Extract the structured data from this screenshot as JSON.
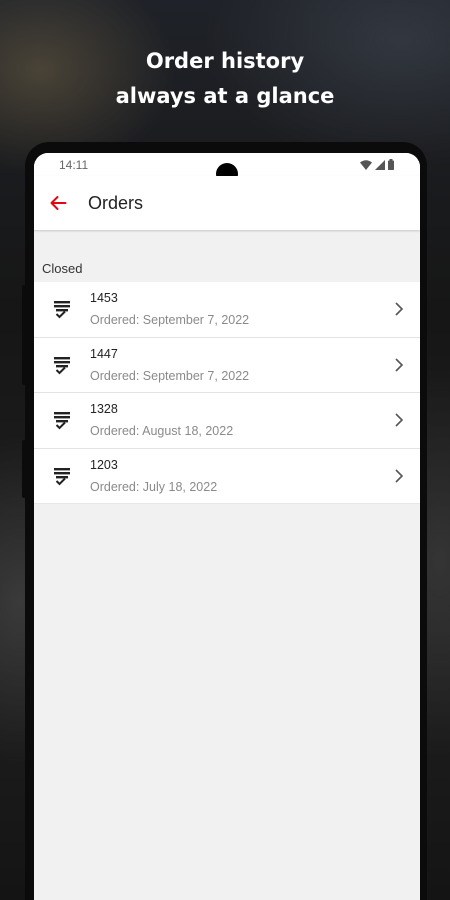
{
  "headline": {
    "line1": "Order history",
    "line2": "always at a glance"
  },
  "status_bar": {
    "time": "14:11"
  },
  "app_bar": {
    "title": "Orders"
  },
  "section": {
    "label": "Closed"
  },
  "orders": [
    {
      "number": "1453",
      "date": "Ordered: September 7, 2022"
    },
    {
      "number": "1447",
      "date": "Ordered: September 7, 2022"
    },
    {
      "number": "1328",
      "date": "Ordered: August 18, 2022"
    },
    {
      "number": "1203",
      "date": "Ordered: July 18, 2022"
    }
  ],
  "icons": {
    "back": "arrow-left-icon",
    "order": "receipt-check-icon",
    "chevron": "chevron-right-icon",
    "wifi": "wifi-icon",
    "signal": "signal-icon",
    "battery": "battery-icon"
  },
  "colors": {
    "accent": "#e30613",
    "background": "#f1f1f1",
    "surface": "#ffffff"
  }
}
